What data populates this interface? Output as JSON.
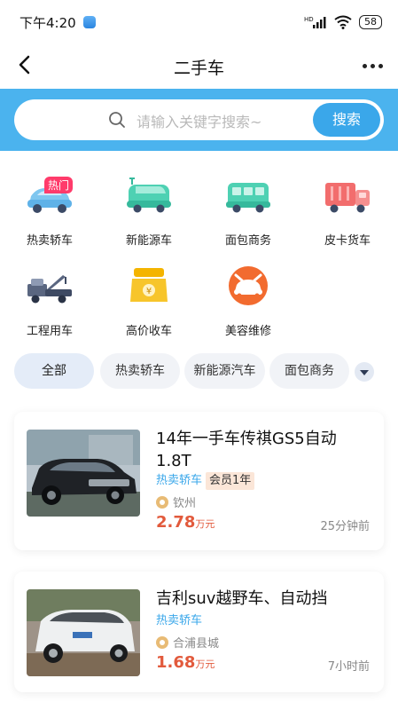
{
  "status_bar": {
    "time": "下午4:20",
    "signal": "HD",
    "battery": "58"
  },
  "nav": {
    "title": "二手车"
  },
  "search": {
    "placeholder": "请输入关键字搜索~",
    "button": "搜索"
  },
  "categories": [
    {
      "label": "热卖轿车",
      "icon": "sedan-icon",
      "badge": "热门"
    },
    {
      "label": "新能源车",
      "icon": "ev-car-icon"
    },
    {
      "label": "面包商务",
      "icon": "van-icon"
    },
    {
      "label": "皮卡货车",
      "icon": "truck-icon"
    },
    {
      "label": "工程用车",
      "icon": "tow-truck-icon"
    },
    {
      "label": "高价收车",
      "icon": "money-bag-icon"
    },
    {
      "label": "美容维修",
      "icon": "car-repair-icon"
    }
  ],
  "filters": [
    "全部",
    "热卖轿车",
    "新能源汽车",
    "面包商务"
  ],
  "listings": [
    {
      "title": "14年一手车传祺GS5自动1.8T",
      "category": "热卖轿车",
      "badge": "会员1年",
      "location": "钦州",
      "price": "2.78",
      "price_unit": "万元",
      "time": "25分钟前"
    },
    {
      "title": "吉利suv越野车、自动挡",
      "category": "热卖轿车",
      "location": "合浦县城",
      "price": "1.68",
      "price_unit": "万元",
      "time": "7小时前"
    }
  ],
  "colors": {
    "accent": "#3aa7ea",
    "price": "#e25a3c",
    "band": "#4bb3ee"
  }
}
